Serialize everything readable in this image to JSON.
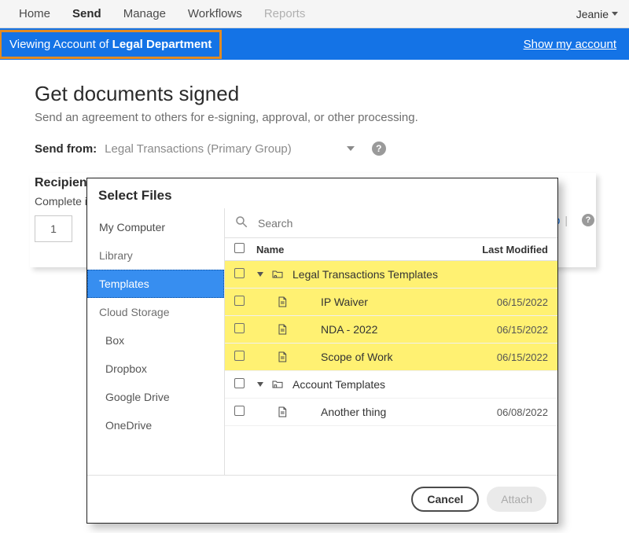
{
  "topnav": {
    "items": [
      "Home",
      "Send",
      "Manage",
      "Workflows",
      "Reports"
    ],
    "active_index": 1,
    "disabled_index": 4,
    "user": "Jeanie"
  },
  "banner": {
    "prefix": "Viewing Account of ",
    "account": "Legal Department",
    "right_link": "Show my account"
  },
  "page": {
    "title": "Get documents signed",
    "subtitle": "Send an agreement to others for e-signing, approval, or other processing.",
    "sendfrom_label": "Send from:",
    "sendfrom_value": "Legal Transactions (Primary Group)",
    "recipients_label": "Recipients",
    "complete_label": "Complete i",
    "order_value": "1",
    "behind_link_suffix": "up",
    "help_glyph": "?"
  },
  "modal": {
    "title": "Select Files",
    "search_placeholder": "Search",
    "sidebar": [
      {
        "label": "My Computer",
        "type": "item"
      },
      {
        "label": "Library",
        "type": "head"
      },
      {
        "label": "Templates",
        "type": "item",
        "selected": true
      },
      {
        "label": "Cloud Storage",
        "type": "head"
      },
      {
        "label": "Box",
        "type": "sub"
      },
      {
        "label": "Dropbox",
        "type": "sub"
      },
      {
        "label": "Google Drive",
        "type": "sub"
      },
      {
        "label": "OneDrive",
        "type": "sub"
      }
    ],
    "columns": {
      "name": "Name",
      "modified": "Last Modified"
    },
    "rows": [
      {
        "kind": "folder",
        "name": "Legal Transactions Templates",
        "modified": "",
        "hl": true,
        "expanded": true
      },
      {
        "kind": "doc",
        "name": "IP Waiver",
        "modified": "06/15/2022",
        "hl": true,
        "child": true
      },
      {
        "kind": "doc",
        "name": "NDA - 2022",
        "modified": "06/15/2022",
        "hl": true,
        "child": true
      },
      {
        "kind": "doc",
        "name": "Scope of Work",
        "modified": "06/15/2022",
        "hl": true,
        "child": true
      },
      {
        "kind": "folder",
        "name": "Account Templates",
        "modified": "",
        "hl": false,
        "expanded": true
      },
      {
        "kind": "doc",
        "name": "Another thing",
        "modified": "06/08/2022",
        "hl": false,
        "child": true
      }
    ],
    "buttons": {
      "cancel": "Cancel",
      "attach": "Attach"
    }
  }
}
